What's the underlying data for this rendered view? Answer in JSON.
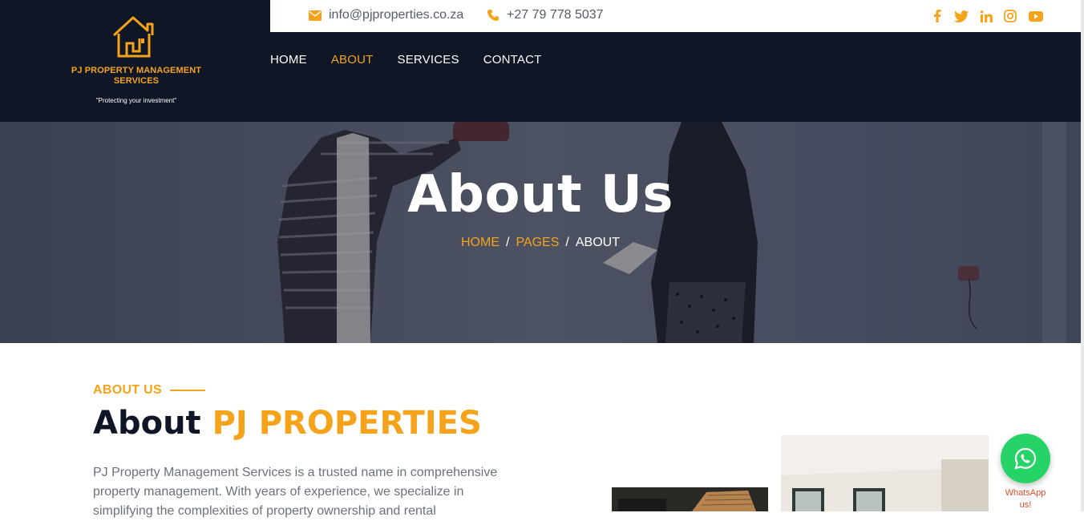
{
  "brand": {
    "name_line1": "PJ  PROPERTY MANAGEMENT",
    "name_line2": "SERVICES",
    "tagline": "\"Protecting your investment\""
  },
  "topbar": {
    "email": "info@pjproperties.co.za",
    "phone": "+27 79 778 5037",
    "social_icons": [
      "facebook-icon",
      "twitter-icon",
      "linkedin-icon",
      "instagram-icon",
      "youtube-icon"
    ]
  },
  "nav": {
    "items": [
      {
        "label": "HOME",
        "active": false
      },
      {
        "label": "ABOUT",
        "active": true
      },
      {
        "label": "SERVICES",
        "active": false
      },
      {
        "label": "CONTACT",
        "active": false
      }
    ]
  },
  "hero": {
    "title": "About Us",
    "breadcrumb": {
      "home": "HOME",
      "pages": "PAGES",
      "current": "ABOUT",
      "separator": "/"
    }
  },
  "about": {
    "tag": "ABOUT US",
    "title_prefix": "About",
    "title_accent": "PJ PROPERTIES",
    "text": "PJ Property Management Services is a trusted name in comprehensive property management. With years of experience, we specialize in simplifying the complexities of property ownership and rental"
  },
  "whatsapp": {
    "label_line1": "WhatsApp",
    "label_line2": "us!"
  },
  "colors": {
    "accent": "#f5a31a",
    "navy": "#0f1626",
    "whatsapp": "#25d366",
    "body_text": "#6b717b"
  }
}
